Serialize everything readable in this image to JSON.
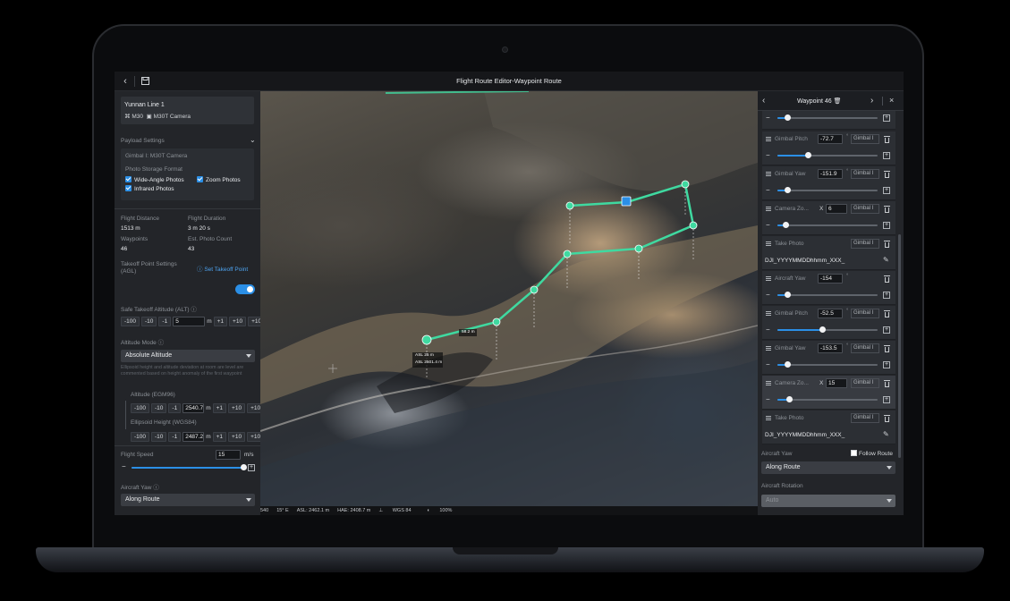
{
  "header": {
    "title": "Flight Route Editor-Waypoint Route",
    "back_icon": "chevron-left-icon",
    "save_icon": "save-icon"
  },
  "left": {
    "route_name": "Yunnan Line 1",
    "aircraft": "M30",
    "camera": "M30T Camera",
    "payload_settings": "Payload Settings",
    "gimbal": "Gimbal I: M30T Camera",
    "photo_storage_format": "Photo Storage Format",
    "wide_angle": "Wide-Angle Photos",
    "zoom": "Zoom Photos",
    "infrared": "Infrared Photos",
    "flight_distance_label": "Flight Distance",
    "flight_distance": "1513 m",
    "flight_duration_label": "Flight Duration",
    "flight_duration": "3 m 20 s",
    "waypoints_label": "Waypoints",
    "waypoints": "46",
    "photo_count_label": "Est. Photo Count",
    "photo_count": "43",
    "takeoff_label_1": "Takeoff Point Settings",
    "takeoff_label_2": "(AGL)",
    "set_takeoff": "Set Takeoff Point",
    "safe_takeoff_label": "Safe Takeoff Altitude (ALT)",
    "safe_takeoff_value": "5",
    "unit_m": "m",
    "minus100": "-100",
    "minus10": "-10",
    "minus1": "-1",
    "plus1": "+1",
    "plus10": "+10",
    "plus100": "+100",
    "altitude_mode_label": "Altitude Mode",
    "altitude_mode": "Absolute Altitude",
    "altitude_note": "Ellipsoid height and altitude deviation at room are level are commented based on height anomaly of the first waypoint",
    "altitude_egm_label": "Altitude (EGM96)",
    "altitude_egm": "2540.7",
    "ellipsoid_label": "Ellipsoid Height (WGS84)",
    "ellipsoid": "2487.2",
    "flight_speed_label": "Flight Speed",
    "flight_speed": "15",
    "speed_unit": "m/s",
    "aircraft_yaw_label": "Aircraft Yaw",
    "aircraft_yaw": "Along Route"
  },
  "map": {
    "segment_label": "58.2 m",
    "asl_label": "ASL 25 m",
    "asl_label2": "ASL 2501.4 m",
    "status": {
      "s1": "540",
      "s2": "15° E",
      "s3": "ASL: 2462.1 m",
      "s4": "HAE: 2408.7 m",
      "s5": "WGS 84",
      "s6": "100%"
    }
  },
  "right": {
    "waypoint_title": "Waypoint 46",
    "actions": [
      {
        "type": "slider",
        "slider": 0.1
      },
      {
        "label": "Gimbal Pitch",
        "value": "-72.7",
        "unit": "°",
        "mode": "Gimbal I",
        "slider": 0.3
      },
      {
        "label": "Gimbal Yaw",
        "value": "-151.9",
        "unit": "°",
        "mode": "Gimbal I",
        "slider": 0.1
      },
      {
        "label": "Camera Zo...",
        "prefix": "X",
        "value": "6",
        "mode": "Gimbal I",
        "slider": 0.08
      },
      {
        "label": "Take Photo",
        "mode": "Gimbal I",
        "filename": "DJI_YYYYMMDDhhmm_XXX_"
      },
      {
        "label": "Aircraft Yaw",
        "value": "-154",
        "unit": "°",
        "slider": 0.1
      },
      {
        "label": "Gimbal Pitch",
        "value": "-52.5",
        "unit": "°",
        "mode": "Gimbal I",
        "slider": 0.45
      },
      {
        "label": "Gimbal Yaw",
        "value": "-153.5",
        "unit": "°",
        "mode": "Gimbal I",
        "slider": 0.1
      },
      {
        "label": "Camera Zo...",
        "prefix": "X",
        "value": "15",
        "mode": "Gimbal I",
        "slider": 0.12
      },
      {
        "label": "Take Photo",
        "mode": "Gimbal I",
        "filename": "DJI_YYYYMMDDhhmm_XXX_"
      }
    ],
    "aircraft_yaw_label": "Aircraft Yaw",
    "follow_route": "Follow Route",
    "aircraft_yaw": "Along Route",
    "aircraft_rotation_label": "Aircraft Rotation",
    "aircraft_rotation": "Auto"
  },
  "colors": {
    "accent": "#2b8fe6",
    "route": "#3fd9a0"
  }
}
